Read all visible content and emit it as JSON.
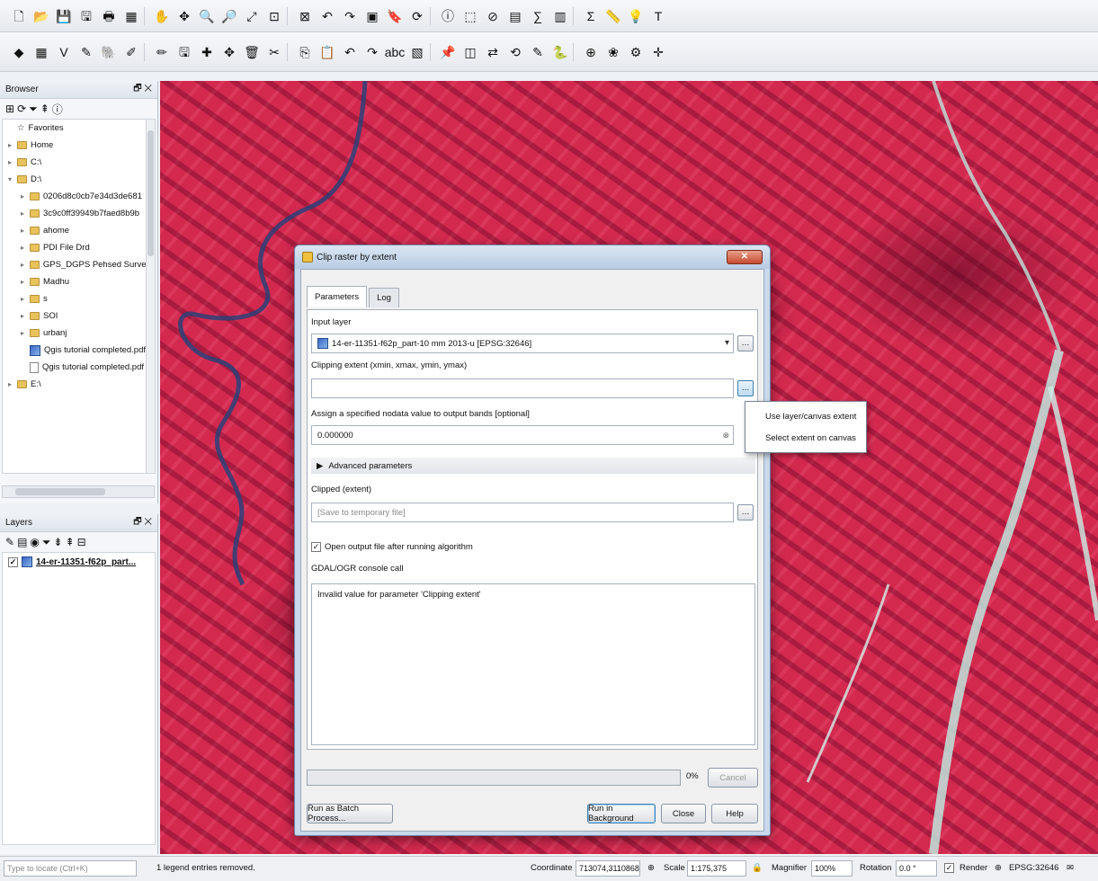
{
  "toolbar": {
    "row1_icons": [
      "new-project-icon",
      "open-project-icon",
      "save-project-icon",
      "save-as-icon",
      "print-layout-icon",
      "layout-manager-icon",
      "pan-icon",
      "pan-to-selection-icon",
      "zoom-in-icon",
      "zoom-out-icon",
      "zoom-full-icon",
      "zoom-to-layer-icon",
      "zoom-selection-icon",
      "zoom-last-icon",
      "zoom-next-icon",
      "new-map-view-icon",
      "bookmarks-icon",
      "refresh-icon",
      "identify-icon",
      "select-icon",
      "deselect-icon",
      "attribute-table-icon",
      "field-calc-icon",
      "statistics-icon",
      "sum-icon",
      "measure-icon",
      "tips-icon",
      "text-annotation-icon"
    ],
    "row2_icons": [
      "add-vector-icon",
      "add-raster-icon",
      "add-csv-icon",
      "add-spatialite-icon",
      "add-postgis-icon",
      "current-edits-icon",
      "toggle-editing-icon",
      "save-edits-icon",
      "add-feature-icon",
      "move-feature-icon",
      "delete-selected-icon",
      "cut-icon",
      "copy-icon",
      "paste-icon",
      "undo-icon",
      "redo-icon",
      "label-icon",
      "layer-labeling-icon",
      "pin-label-icon",
      "show-label-icon",
      "move-label-icon",
      "rotate-label-icon",
      "change-label-icon",
      "python-console-icon",
      "georeferencer-icon",
      "grass-icon",
      "processing-toolbox-icon",
      "crosshair-icon"
    ]
  },
  "browser": {
    "title": "Browser",
    "items": [
      {
        "label": "Favorites",
        "type": "star",
        "indent": 0,
        "exp": ""
      },
      {
        "label": "Home",
        "type": "folder",
        "indent": 0,
        "exp": "▸"
      },
      {
        "label": "C:\\",
        "type": "folder",
        "indent": 0,
        "exp": "▸"
      },
      {
        "label": "D:\\",
        "type": "folder",
        "indent": 0,
        "exp": "▾"
      },
      {
        "label": "0206d8c0cb7e34d3de681",
        "type": "folder",
        "indent": 1,
        "exp": "▸"
      },
      {
        "label": "3c9c0ff39949b7faed8b9b",
        "type": "folder",
        "indent": 1,
        "exp": "▸"
      },
      {
        "label": "ahome",
        "type": "folder",
        "indent": 1,
        "exp": "▸"
      },
      {
        "label": "PDI File Drd",
        "type": "folder",
        "indent": 1,
        "exp": "▸"
      },
      {
        "label": "GPS_DGPS Pehsed Surveys",
        "type": "folder",
        "indent": 1,
        "exp": "▸"
      },
      {
        "label": "Madhu",
        "type": "folder",
        "indent": 1,
        "exp": "▸"
      },
      {
        "label": "s",
        "type": "folder",
        "indent": 1,
        "exp": "▸"
      },
      {
        "label": "SOI",
        "type": "folder",
        "indent": 1,
        "exp": "▸"
      },
      {
        "label": "urbanj",
        "type": "folder",
        "indent": 1,
        "exp": "▸"
      },
      {
        "label": "Qgis tutorial completed.pdf",
        "type": "raster",
        "indent": 1,
        "exp": ""
      },
      {
        "label": "Qgis tutorial completed.pdf",
        "type": "file",
        "indent": 1,
        "exp": ""
      },
      {
        "label": "E:\\",
        "type": "folder",
        "indent": 0,
        "exp": "▸"
      }
    ]
  },
  "layers": {
    "title": "Layers",
    "items": [
      {
        "label": "14-er-11351-f62p_part..."
      }
    ]
  },
  "dialog": {
    "title": "Clip raster by extent",
    "tabs": [
      "Parameters",
      "Log"
    ],
    "input_layer_label": "Input layer",
    "input_layer_value": "14-er-11351-f62p_part-10 mm 2013-u [EPSG:32646]",
    "clip_extent_label": "Clipping extent (xmin, xmax, ymin, ymax)",
    "clip_extent_value": "",
    "nodata_label": "Assign a specified nodata value to output bands [optional]",
    "nodata_value": "0.000000",
    "advanced_label": "Advanced parameters",
    "clipped_label": "Clipped (extent)",
    "clipped_placeholder": "[Save to temporary file]",
    "open_output_label": "Open output file after running algorithm",
    "console_label": "GDAL/OGR console call",
    "console_text": "Invalid value for parameter 'Clipping extent'",
    "progress_pct": "0%",
    "cancel": "Cancel",
    "batch": "Run as Batch Process...",
    "run_bg": "Run in Background",
    "close": "Close",
    "help": "Help"
  },
  "popup": {
    "items": [
      "Use layer/canvas extent",
      "Select extent on canvas"
    ]
  },
  "status": {
    "search_placeholder": "Type to locate (Ctrl+K)",
    "message": "1 legend entries removed.",
    "coordinate_label": "Coordinate",
    "coordinate_value": "713074,3110868",
    "scale_label": "Scale",
    "scale_value": "1:175,375",
    "magnifier_label": "Magnifier",
    "magnifier_value": "100%",
    "rotation_label": "Rotation",
    "rotation_value": "0.0 °",
    "render_label": "Render",
    "crs": "EPSG:32646"
  }
}
